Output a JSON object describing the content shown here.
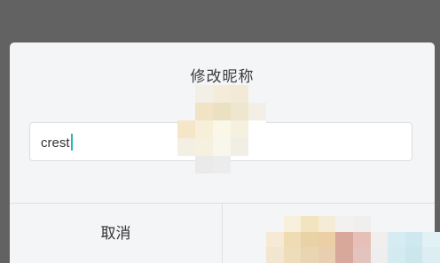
{
  "dialog": {
    "title": "修改昵称",
    "nickname_input": {
      "value": "crest",
      "placeholder": ""
    },
    "buttons": {
      "cancel_label": "取消",
      "confirm_label": ""
    }
  },
  "colors": {
    "overlay": "#626262",
    "dialog_bg": "#f4f5f7",
    "accent": "#2fb4a6"
  }
}
